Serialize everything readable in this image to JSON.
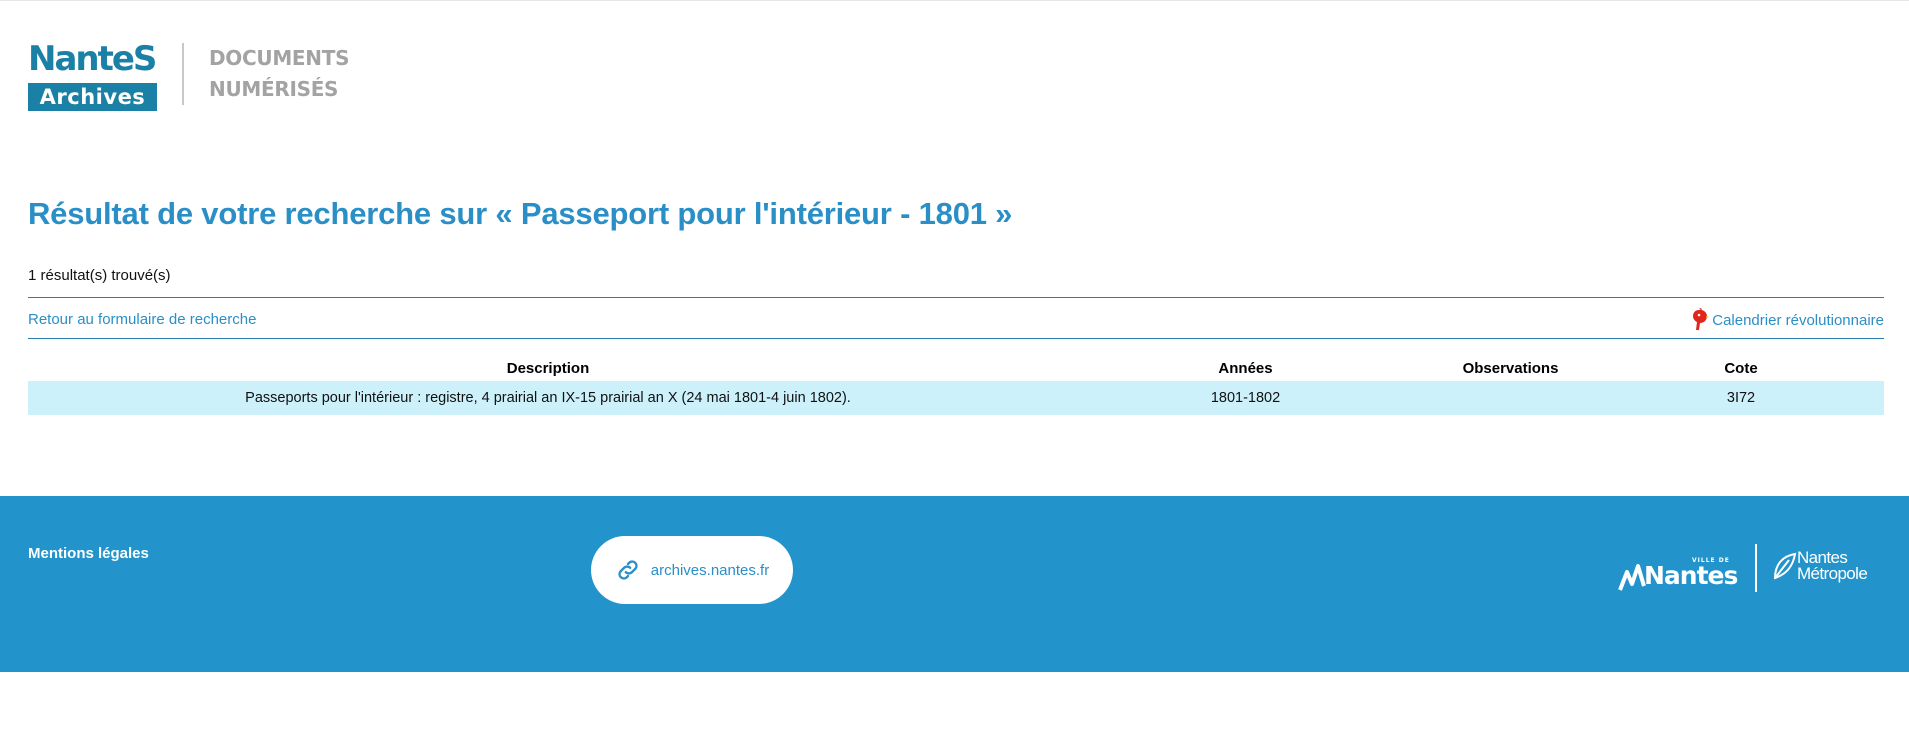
{
  "header": {
    "logo_top": "NanteS",
    "logo_box": "Archives",
    "title_line1": "DOCUMENTS",
    "title_line2": "NUMÉRISÉS"
  },
  "main": {
    "title": "Résultat de votre recherche sur « Passeport pour l'intérieur - 1801 »",
    "result_count": "1 résultat(s) trouvé(s)",
    "back_link": "Retour au formulaire de recherche",
    "calendar_link": "Calendrier révolutionnaire"
  },
  "table": {
    "headers": {
      "description": "Description",
      "years": "Années",
      "observations": "Observations",
      "cote": "Cote"
    },
    "rows": [
      {
        "description": "Passeports pour l'intérieur : registre, 4 prairial an IX-15 prairial an X (24 mai 1801-4 juin 1802).",
        "years": "1801-1802",
        "observations": "",
        "cote": "3I72"
      }
    ]
  },
  "footer": {
    "legal": "Mentions légales",
    "site_link": "archives.nantes.fr",
    "ville_small": "VILLE DE",
    "ville_name": "Nantes",
    "metro_line1": "Nantes",
    "metro_line2": "Métropole"
  },
  "colors": {
    "accent": "#2a8fc6",
    "footer_bg": "#2394cb",
    "row_highlight": "#cdf1fb",
    "logo_blue": "#1a80a6"
  },
  "icons": [
    "rooster-icon",
    "link-icon"
  ]
}
